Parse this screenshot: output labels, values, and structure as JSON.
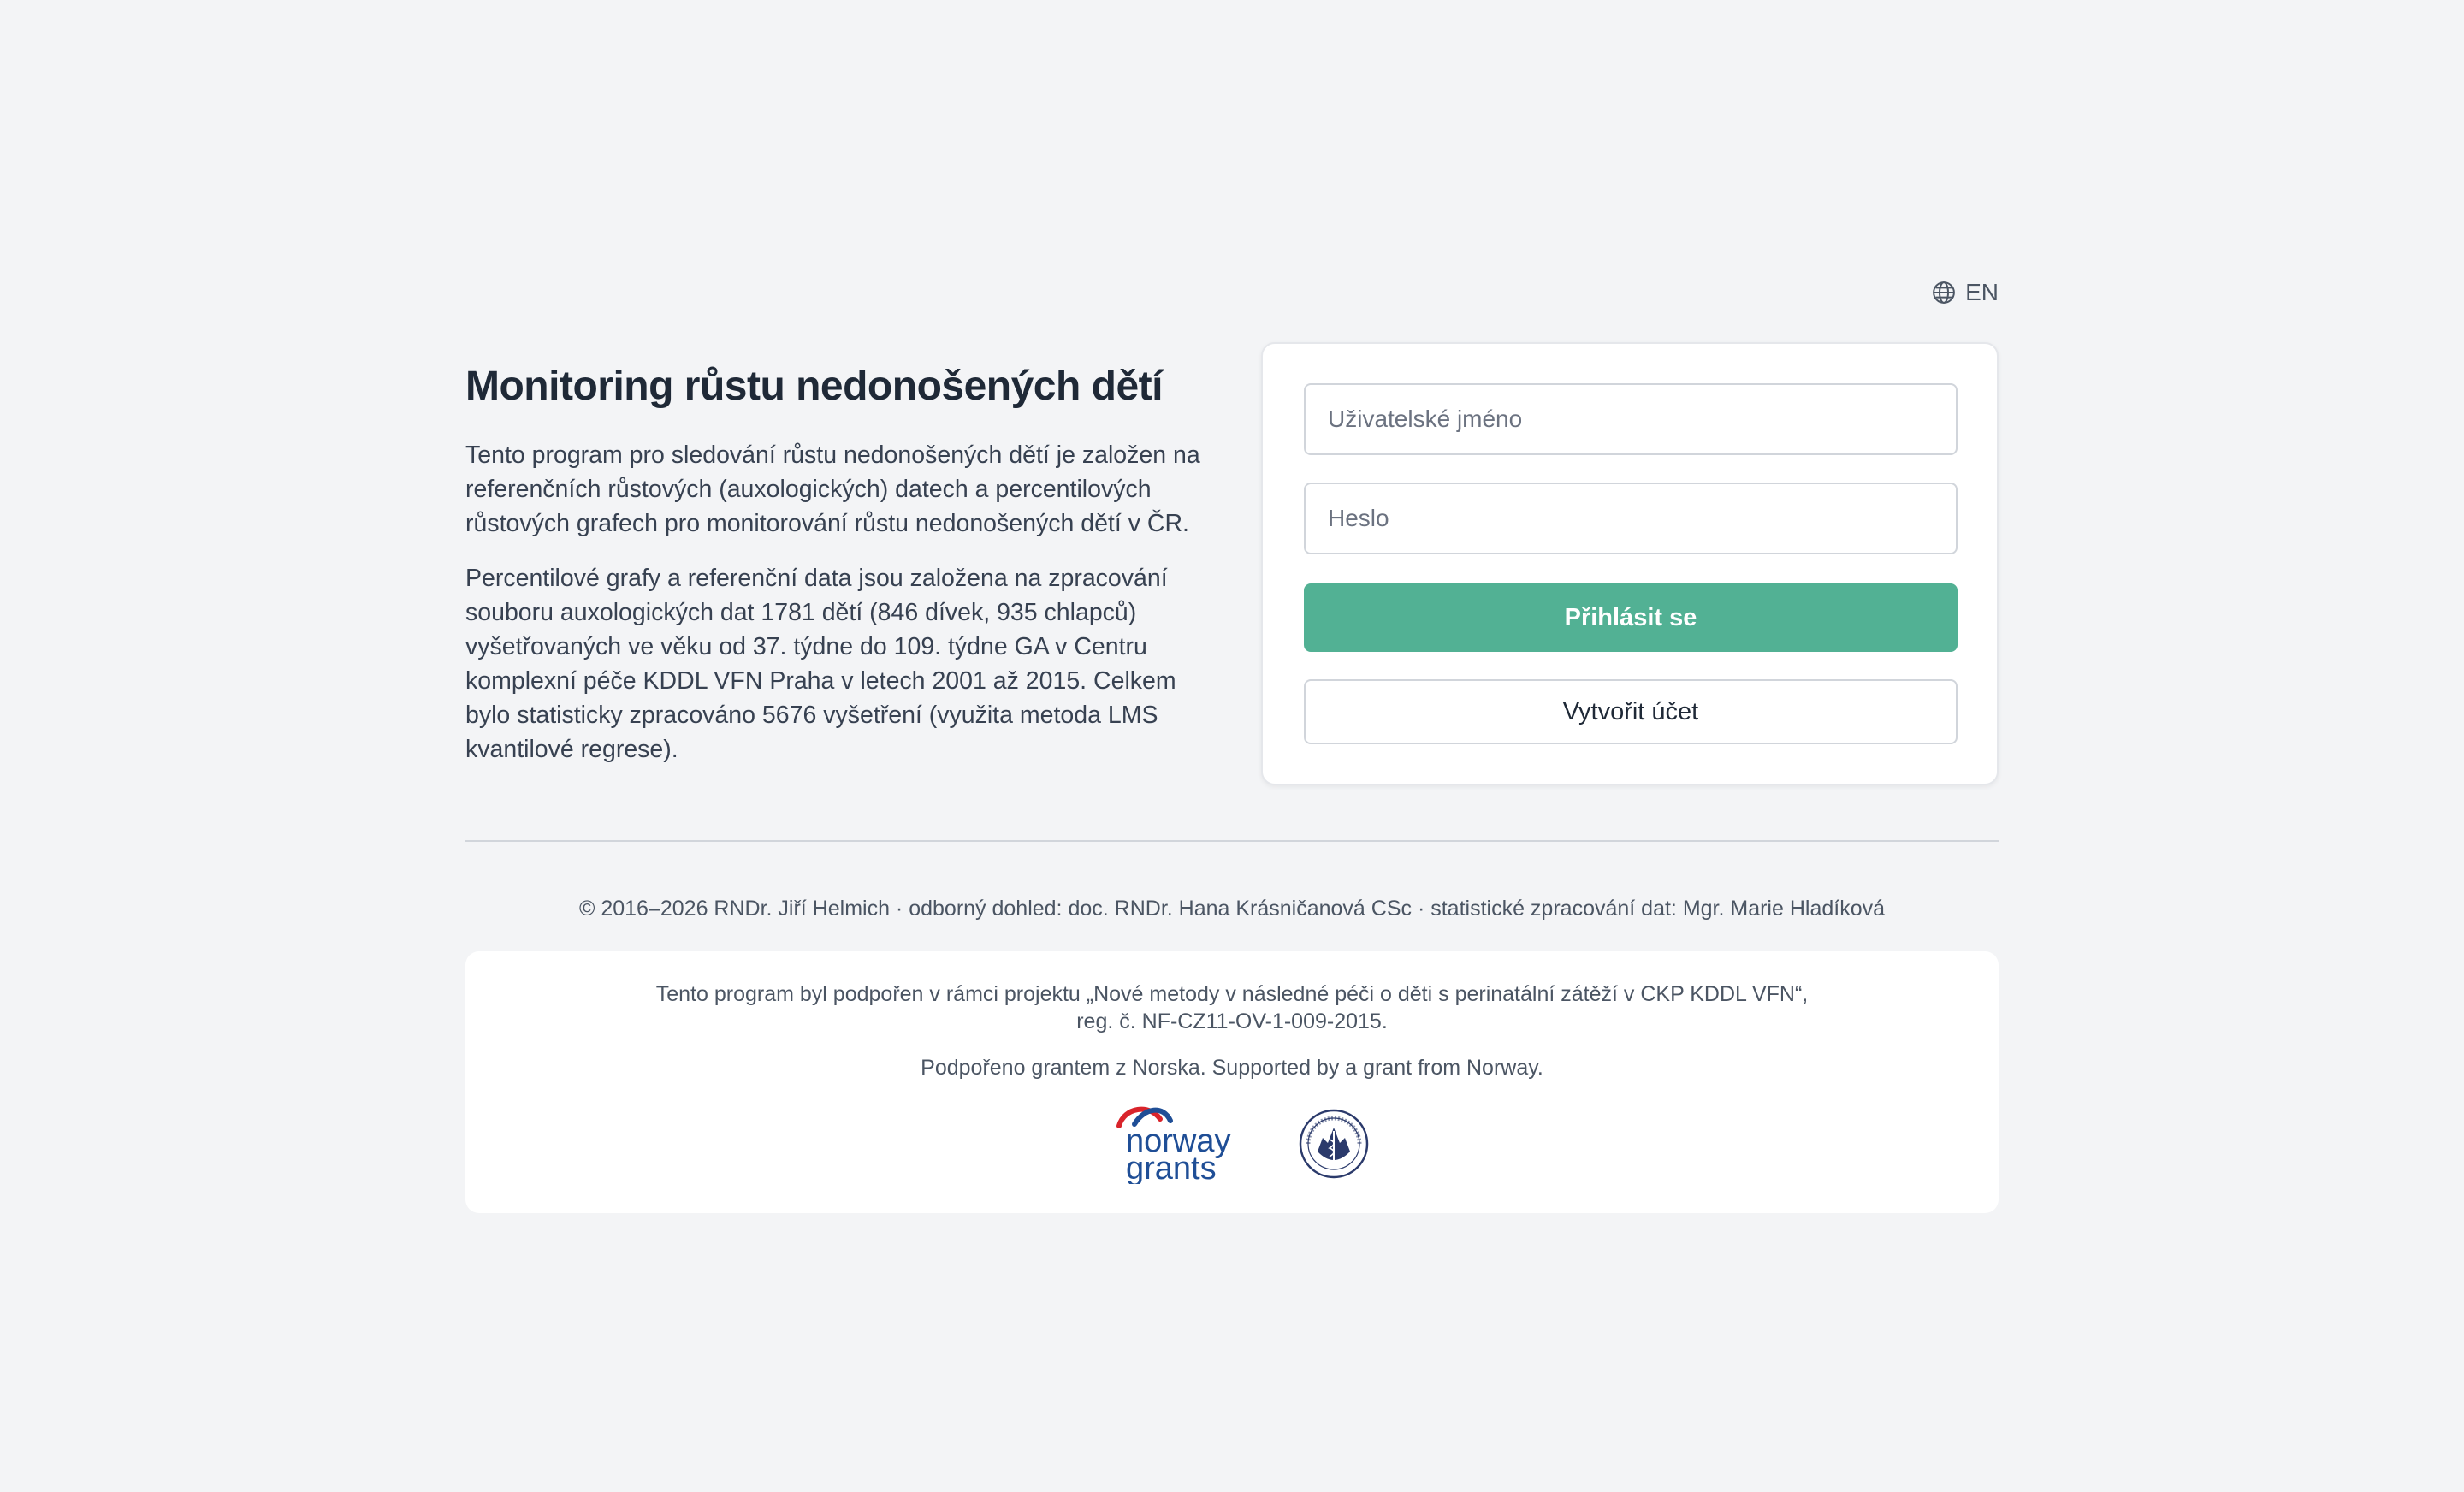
{
  "language": {
    "label": "EN"
  },
  "intro": {
    "title": "Monitoring růstu nedonošených dětí",
    "paragraph1": "Tento program pro sledování růstu nedonošených dětí je založen na referenčních růstových (auxologických) datech a percentilových růstových grafech pro monitorování růstu nedonošených dětí v ČR.",
    "paragraph2": "Percentilové grafy a referenční data jsou založena na zpracování souboru auxologických dat 1781 dětí (846 dívek, 935 chlapců) vyšetřovaných ve věku od 37. týdne do 109. týdne GA v Centru komplexní péče KDDL VFN Praha v letech 2001 až 2015. Celkem bylo statisticky zpracováno 5676 vyšetření (využita metoda LMS kvantilové regrese)."
  },
  "login": {
    "username_placeholder": "Uživatelské jméno",
    "username_value": "",
    "password_placeholder": "Heslo",
    "password_value": "",
    "login_label": "Přihlásit se",
    "create_label": "Vytvořit účet"
  },
  "footer": {
    "copyright": "© 2016–2026 RNDr. Jiří Helmich · odborný dohled: doc. RNDr. Hana Krásničanová CSc · statistické zpracování dat: Mgr. Marie Hladíková",
    "support_line1": "Tento program byl podpořen v rámci projektu „Nové metody v následné péči o děti s perinatální zátěží v CKP KDDL VFN“,",
    "support_line2": "reg. č. NF-CZ11-OV-1-009-2015.",
    "grant": "Podpořeno grantem z Norska. Supported by a grant from Norway.",
    "logo_norway_word1": "norway",
    "logo_norway_word2": "grants"
  },
  "colors": {
    "primary": "#52b194",
    "background": "#f3f4f6",
    "norway_blue": "#1f4e96",
    "norway_red": "#d9242b",
    "seal_navy": "#2b3a6b"
  },
  "icons": {
    "language": "globe-icon"
  }
}
